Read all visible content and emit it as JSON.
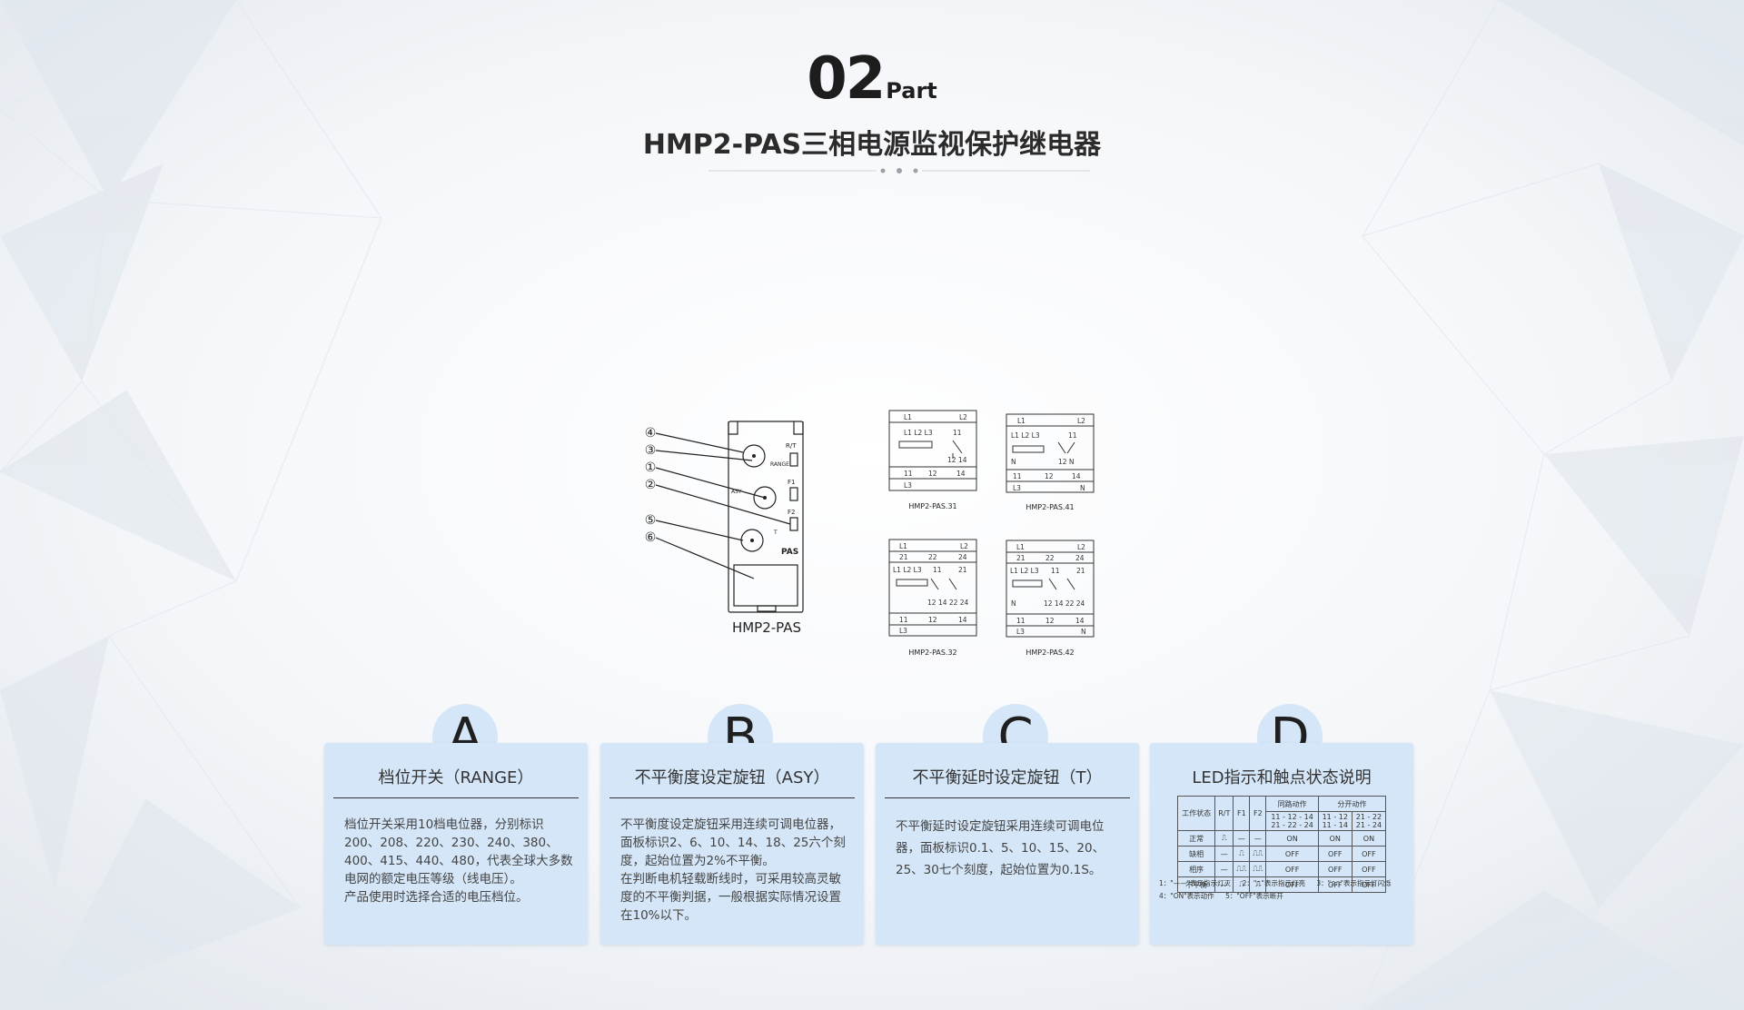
{
  "header": {
    "part_number": "02",
    "part_label": "Part",
    "title": "HMP2-PAS三相电源监视保护继电器"
  },
  "relay": {
    "model_label": "HMP2-PAS",
    "face_label": "PAS",
    "callouts": [
      "④",
      "③",
      "①",
      "②",
      "⑤",
      "⑥"
    ],
    "knob_labels": [
      "RANGE",
      "ASY",
      "T"
    ],
    "led_labels": [
      "R/T",
      "F1",
      "F2"
    ]
  },
  "wiring": {
    "models": [
      "HMP2-PAS.31",
      "HMP2-PAS.41",
      "HMP2-PAS.32",
      "HMP2-PAS.42"
    ]
  },
  "cards": [
    {
      "letter": "A",
      "title": "档位开关（RANGE）",
      "body": [
        "档位开关采用10档电位器，分别标识200、208、220、230、240、380、400、415、440、480，代表全球大多数电网的额定电压等级（线电压）。",
        "产品使用时选择合适的电压档位。"
      ]
    },
    {
      "letter": "B",
      "title": "不平衡度设定旋钮（ASY）",
      "body": [
        "不平衡度设定旋钮采用连续可调电位器，面板标识2、6、10、14、18、25六个刻度，起始位置为2%不平衡。",
        "在判断电机轻载断线时，可采用较高灵敏度的不平衡判据，一般根据实际情况设置在10%以下。"
      ]
    },
    {
      "letter": "C",
      "title": "不平衡延时设定旋钮（T）",
      "body": [
        "不平衡延时设定旋钮采用连续可调电位器，面板标识0.1、5、10、15、20、25、30七个刻度，起始位置为0.1S。"
      ]
    },
    {
      "letter": "D",
      "title": "LED指示和触点状态说明"
    }
  ],
  "led_table": {
    "headers": [
      "工作状态",
      "R/T",
      "F1",
      "F2",
      "同路动作",
      "分开动作"
    ],
    "sub_headers": [
      "11 - 12 - 14\n21 - 22 - 24",
      "11 - 12\n11 - 14",
      "21 - 22\n21 - 24"
    ],
    "rows": [
      [
        "正常",
        "⎍",
        "—",
        "—",
        "ON",
        "ON",
        "ON"
      ],
      [
        "缺相",
        "—",
        "⎍",
        "⎍⎍",
        "OFF",
        "OFF",
        "OFF"
      ],
      [
        "相序",
        "—",
        "⎍⎍",
        "⎍⎍",
        "OFF",
        "OFF",
        "OFF"
      ],
      [
        "不平衡",
        "—",
        "⎍",
        "⎍",
        "OFF",
        "OFF",
        "OFF"
      ]
    ],
    "notes": [
      "1：\"——\"表示指示灯灭",
      "2：\"⎍\"表示指示灯亮",
      "3：\"⎍⎍\"表示指示灯闪烁",
      "4：\"ON\"表示动作",
      "5：\"OFF\"表示断开"
    ]
  }
}
